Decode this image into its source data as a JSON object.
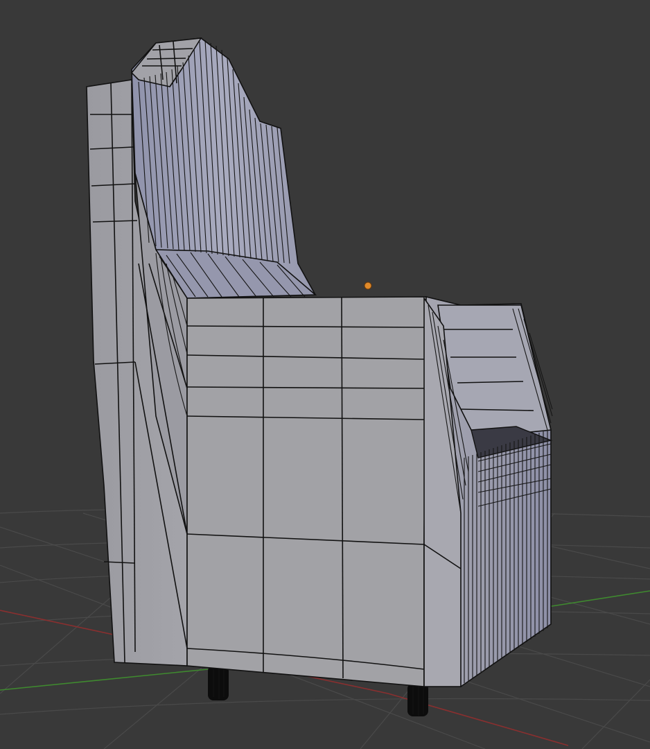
{
  "viewport": {
    "background": "#393939",
    "grid_color": "#4a4a4a",
    "x_axis_color": "#8a2f2f",
    "y_axis_color": "#3f8a2f",
    "mesh_color": "#a3a3a9",
    "mesh_shadow_color": "#8d8fa6",
    "wire_color": "#111111",
    "origin_color": "#e08a2a"
  },
  "object": {
    "icon": "armchair-mesh",
    "mode": "edit-wireframe"
  }
}
